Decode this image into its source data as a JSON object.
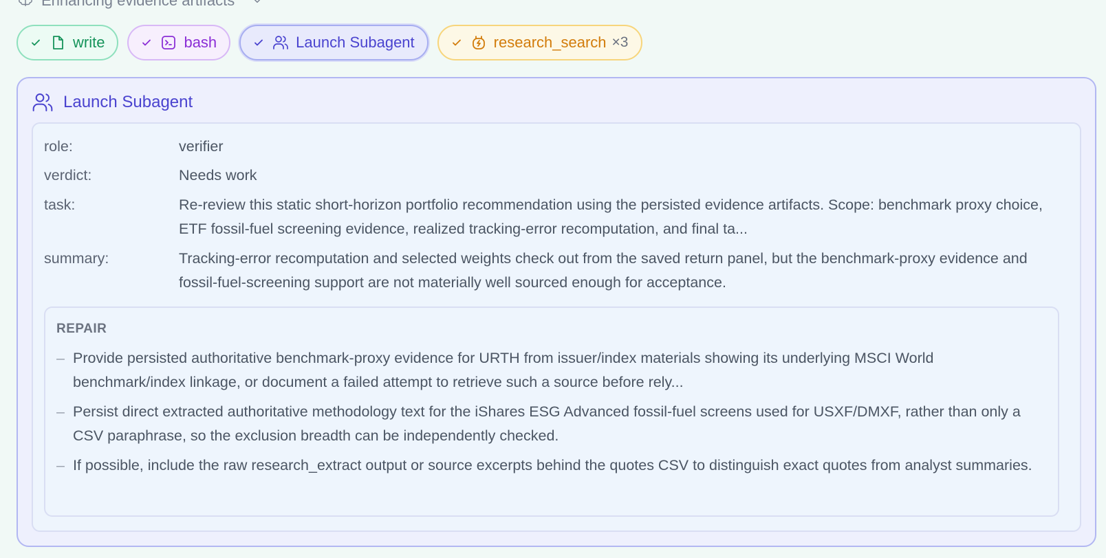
{
  "header": {
    "title": "Enhancing evidence artifacts"
  },
  "chips": [
    {
      "label": "write",
      "count": ""
    },
    {
      "label": "bash",
      "count": ""
    },
    {
      "label": "Launch Subagent",
      "count": ""
    },
    {
      "label": "research_search",
      "count": "×3"
    }
  ],
  "panel": {
    "title": "Launch Subagent",
    "fields": {
      "role": {
        "key": "role:",
        "value": "verifier"
      },
      "verdict": {
        "key": "verdict:",
        "value": "Needs work"
      },
      "task": {
        "key": "task:",
        "value": "Re-review this static short-horizon portfolio recommendation using the persisted evidence artifacts. Scope: benchmark proxy choice, ETF fossil-fuel screening evidence, realized tracking-error recomputation, and final ta..."
      },
      "summary": {
        "key": "summary:",
        "value": "Tracking-error recomputation and selected weights check out from the saved return panel, but the benchmark-proxy evidence and fossil-fuel-screening support are not materially well sourced enough for acceptance."
      }
    },
    "repair": {
      "title": "REPAIR",
      "items": [
        "Provide persisted authoritative benchmark-proxy evidence for URTH from issuer/index materials showing its underlying MSCI World benchmark/index linkage, or document a failed attempt to retrieve such a source before rely...",
        "Persist direct extracted authoritative methodology text for the iShares ESG Advanced fossil-fuel screens used for USXF/DMXF, rather than only a CSV paraphrase, so the exclusion breadth can be independently checked.",
        "If possible, include the raw research_extract output or source excerpts behind the quotes CSV to distinguish exact quotes from analyst summaries."
      ]
    }
  },
  "colors": {
    "write": "#15935a",
    "bash": "#8b2ed6",
    "subagent": "#4a43cf",
    "research": "#d27c0b"
  },
  "icons": [
    "brain-icon",
    "chevron-down-icon",
    "check-icon",
    "file-icon",
    "terminal-icon",
    "users-icon",
    "search-bolt-icon"
  ]
}
